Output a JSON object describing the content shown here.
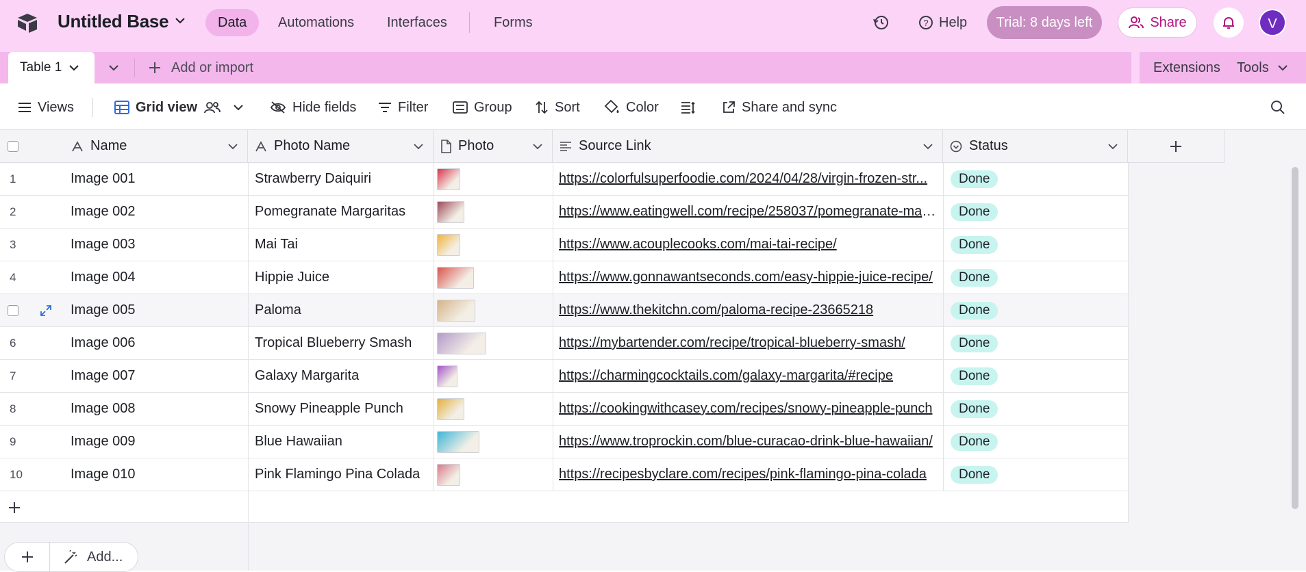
{
  "app": {
    "base_name": "Untitled Base",
    "nav": [
      "Data",
      "Automations",
      "Interfaces",
      "Forms"
    ],
    "help_label": "Help",
    "trial_label": "Trial: 8 days left",
    "share_label": "Share",
    "avatar_initial": "V",
    "accent_color": "#fbd4f7"
  },
  "tabs": {
    "table_tab": "Table 1",
    "add_import": "Add or import",
    "extensions": "Extensions",
    "tools": "Tools"
  },
  "viewbar": {
    "views": "Views",
    "grid_view": "Grid view",
    "hide_fields": "Hide fields",
    "filter": "Filter",
    "group": "Group",
    "sort": "Sort",
    "color": "Color",
    "share_sync": "Share and sync"
  },
  "columns": [
    "Name",
    "Photo Name",
    "Photo",
    "Source Link",
    "Status"
  ],
  "rows": [
    {
      "num": "1",
      "name": "Image 001",
      "photo_name": "Strawberry Daiquiri",
      "link": "https://colorfulsuperfoodie.com/2024/04/28/virgin-frozen-str...",
      "status": "Done"
    },
    {
      "num": "2",
      "name": "Image 002",
      "photo_name": "Pomegranate Margaritas",
      "link": "https://www.eatingwell.com/recipe/258037/pomegranate-mar...",
      "status": "Done"
    },
    {
      "num": "3",
      "name": "Image 003",
      "photo_name": "Mai Tai",
      "link": "https://www.acouplecooks.com/mai-tai-recipe/",
      "status": "Done"
    },
    {
      "num": "4",
      "name": "Image 004",
      "photo_name": "Hippie Juice",
      "link": "https://www.gonnawantseconds.com/easy-hippie-juice-recipe/",
      "status": "Done"
    },
    {
      "num": "5",
      "name": "Image 005",
      "photo_name": "Paloma",
      "link": "https://www.thekitchn.com/paloma-recipe-23665218",
      "status": "Done"
    },
    {
      "num": "6",
      "name": "Image 006",
      "photo_name": "Tropical Blueberry Smash",
      "link": "https://mybartender.com/recipe/tropical-blueberry-smash/",
      "status": "Done"
    },
    {
      "num": "7",
      "name": "Image 007",
      "photo_name": "Galaxy Margarita",
      "link": "https://charmingcocktails.com/galaxy-margarita/#recipe",
      "status": "Done"
    },
    {
      "num": "8",
      "name": "Image 008",
      "photo_name": "Snowy Pineapple Punch",
      "link": "https://cookingwithcasey.com/recipes/snowy-pineapple-punch",
      "status": "Done"
    },
    {
      "num": "9",
      "name": "Image 009",
      "photo_name": "Blue Hawaiian",
      "link": "https://www.troprockin.com/blue-curacao-drink-blue-hawaiian/",
      "status": "Done"
    },
    {
      "num": "10",
      "name": "Image 010",
      "photo_name": "Pink Flamingo Pina Colada",
      "link": "https://recipesbyclare.com/recipes/pink-flamingo-pina-colada",
      "status": "Done"
    }
  ],
  "footer": {
    "add_label": "Add..."
  }
}
